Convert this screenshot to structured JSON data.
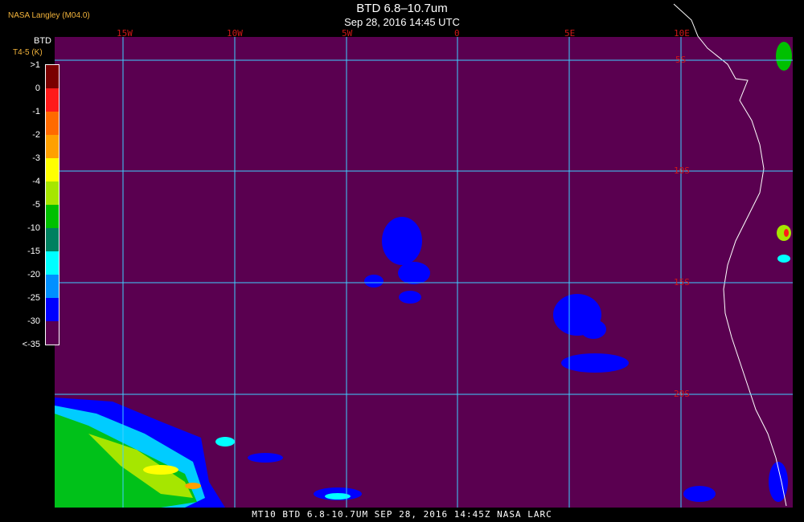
{
  "header": {
    "source": "NASA Langley (M04.0)",
    "title": "BTD 6.8–10.7um",
    "datetime": "Sep 28, 2016 14:45 UTC"
  },
  "legend": {
    "title": "BTD",
    "unit": "T4-5 (K)",
    "labels": [
      ">1",
      "0",
      "-1",
      "-2",
      "-3",
      "-4",
      "-5",
      "-10",
      "-15",
      "-20",
      "-25",
      "-30",
      "<-35"
    ],
    "colors": [
      "#7a0000",
      "#ff1a1a",
      "#ff6a00",
      "#ffa000",
      "#ffff00",
      "#a6e600",
      "#00c000",
      "#008060",
      "#00ffff",
      "#0090ff",
      "#0000ff",
      "#5a0050"
    ]
  },
  "grid": {
    "lon_labels": [
      "15W",
      "10W",
      "5W",
      "0",
      "5E",
      "10E"
    ],
    "lat_labels": [
      "5S",
      "10S",
      "15S",
      "20S"
    ],
    "line_color": "#3fd0ff",
    "label_color": "#d01818"
  },
  "map": {
    "background": "#5a0050",
    "coast_color": "#ffffff"
  },
  "footer": {
    "text": "MT10  BTD 6.8-10.7UM   SEP 28, 2016 14:45Z   NASA LARC"
  }
}
